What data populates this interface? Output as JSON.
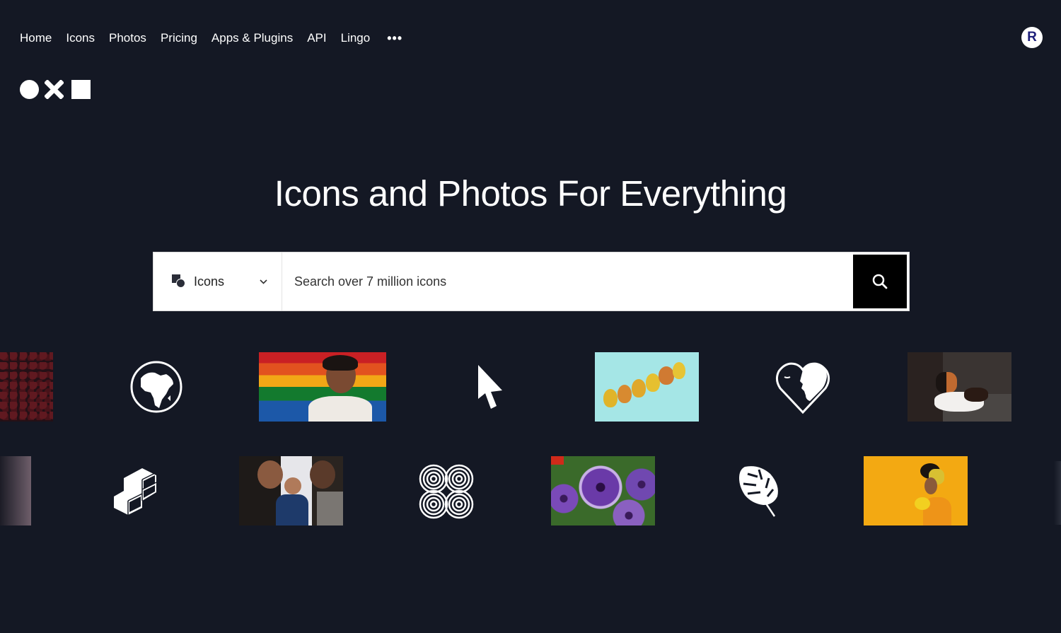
{
  "nav": {
    "items": [
      {
        "label": "Home"
      },
      {
        "label": "Icons"
      },
      {
        "label": "Photos"
      },
      {
        "label": "Pricing"
      },
      {
        "label": "Apps & Plugins"
      },
      {
        "label": "API"
      },
      {
        "label": "Lingo"
      }
    ],
    "more_label": "•••"
  },
  "user": {
    "avatar_initial": "R",
    "avatar_color": "#1d1e7a"
  },
  "logo": {
    "shapes": [
      "circle",
      "x",
      "square"
    ]
  },
  "hero": {
    "title": "Icons and Photos For Everything"
  },
  "search": {
    "type_selected": "Icons",
    "type_icon": "shapes-icon",
    "placeholder": "Search over 7 million icons",
    "value": "",
    "submit_icon": "search-icon"
  },
  "gallery": {
    "row1": [
      {
        "kind": "photo",
        "subject": "cherries"
      },
      {
        "kind": "icon",
        "subject": "globe-africa-icon"
      },
      {
        "kind": "photo",
        "subject": "person with rainbow flag"
      },
      {
        "kind": "icon",
        "subject": "cursor-arrow-icon"
      },
      {
        "kind": "photo",
        "subject": "pears in a row"
      },
      {
        "kind": "icon",
        "subject": "heart-face-icon"
      },
      {
        "kind": "photo",
        "subject": "calico cat on couch"
      }
    ],
    "row2": [
      {
        "kind": "photo",
        "subject": "faded partial photo"
      },
      {
        "kind": "icon",
        "subject": "isometric-blocks-icon"
      },
      {
        "kind": "photo",
        "subject": "family with baby"
      },
      {
        "kind": "icon",
        "subject": "concentric-circles-pattern-icon"
      },
      {
        "kind": "photo",
        "subject": "purple petunias"
      },
      {
        "kind": "icon",
        "subject": "monstera-leaf-icon"
      },
      {
        "kind": "photo",
        "subject": "woman with yellow headwrap and flowers"
      }
    ]
  }
}
